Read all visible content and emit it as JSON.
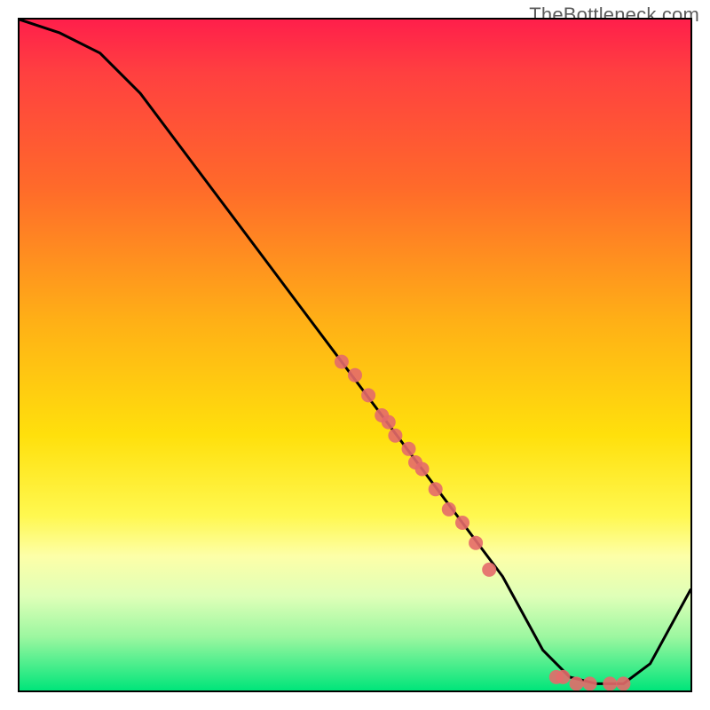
{
  "watermark": {
    "text": "TheBottleneck.com"
  },
  "chart_data": {
    "type": "line",
    "title": "",
    "xlabel": "",
    "ylabel": "",
    "xlim": [
      0,
      100
    ],
    "ylim": [
      0,
      100
    ],
    "grid": false,
    "legend": false,
    "series": [
      {
        "name": "curve",
        "x": [
          0,
          6,
          12,
          18,
          24,
          30,
          36,
          42,
          48,
          54,
          60,
          66,
          72,
          78,
          82,
          86,
          90,
          94,
          100
        ],
        "y": [
          100,
          98,
          95,
          89,
          81,
          73,
          65,
          57,
          49,
          41,
          33,
          25,
          17,
          6,
          2,
          1,
          1,
          4,
          15
        ]
      }
    ],
    "scatter": [
      {
        "name": "points-on-curve",
        "x": [
          48,
          50,
          52,
          54,
          55,
          56,
          58,
          59,
          60,
          62,
          64,
          66,
          68,
          70,
          80,
          81,
          83,
          85,
          88,
          90
        ],
        "y": [
          49,
          47,
          44,
          41,
          40,
          38,
          36,
          34,
          33,
          30,
          27,
          25,
          22,
          18,
          2,
          2,
          1,
          1,
          1,
          1
        ]
      }
    ]
  }
}
